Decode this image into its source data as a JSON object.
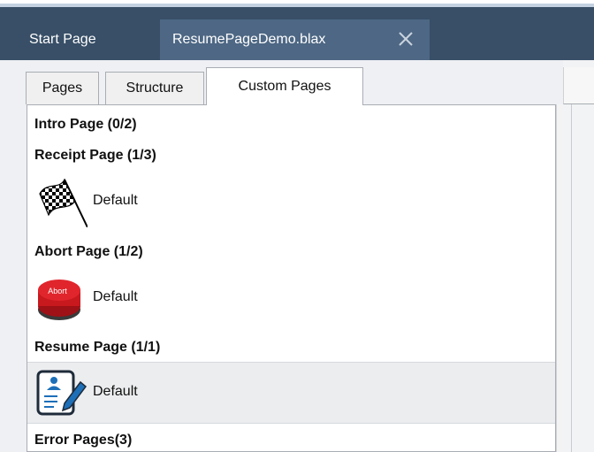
{
  "doc_tabs": [
    {
      "label": "Start Page"
    },
    {
      "label": "ResumePageDemo.blax"
    }
  ],
  "sub_tabs": [
    {
      "label": "Pages"
    },
    {
      "label": "Structure"
    },
    {
      "label": "Custom Pages"
    }
  ],
  "custom_pages": {
    "intro": {
      "heading": "Intro Page (0/2)"
    },
    "receipt": {
      "heading": "Receipt Page (1/3)",
      "item": "Default"
    },
    "abort": {
      "heading": "Abort Page (1/2)",
      "item": "Default",
      "icon_text": "Abort"
    },
    "resume": {
      "heading": "Resume Page (1/1)",
      "item": "Default"
    },
    "error": {
      "heading": "Error Pages(3)"
    }
  },
  "colors": {
    "tabbar": "#384f67",
    "active_tab": "#4d6784",
    "abort_red": "#c8191f",
    "resume_blue": "#1d6fb8"
  }
}
